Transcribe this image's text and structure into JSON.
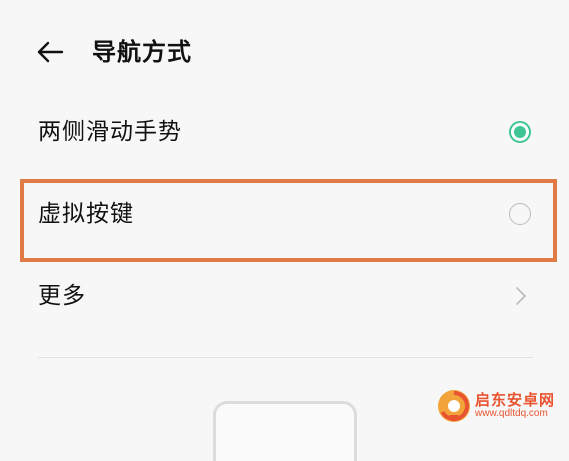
{
  "header": {
    "back_icon": "arrow-left-icon",
    "title": "导航方式"
  },
  "options": [
    {
      "label": "两侧滑动手势",
      "selected": true
    },
    {
      "label": "虚拟按键",
      "selected": false
    }
  ],
  "more": {
    "label": "更多",
    "icon": "chevron-right-icon"
  },
  "colors": {
    "accent": "#3fc493",
    "highlight": "#e07a47",
    "background": "#f7f7f7"
  },
  "watermark": {
    "name": "启东安卓网",
    "url": "www.qdltdq.com"
  }
}
